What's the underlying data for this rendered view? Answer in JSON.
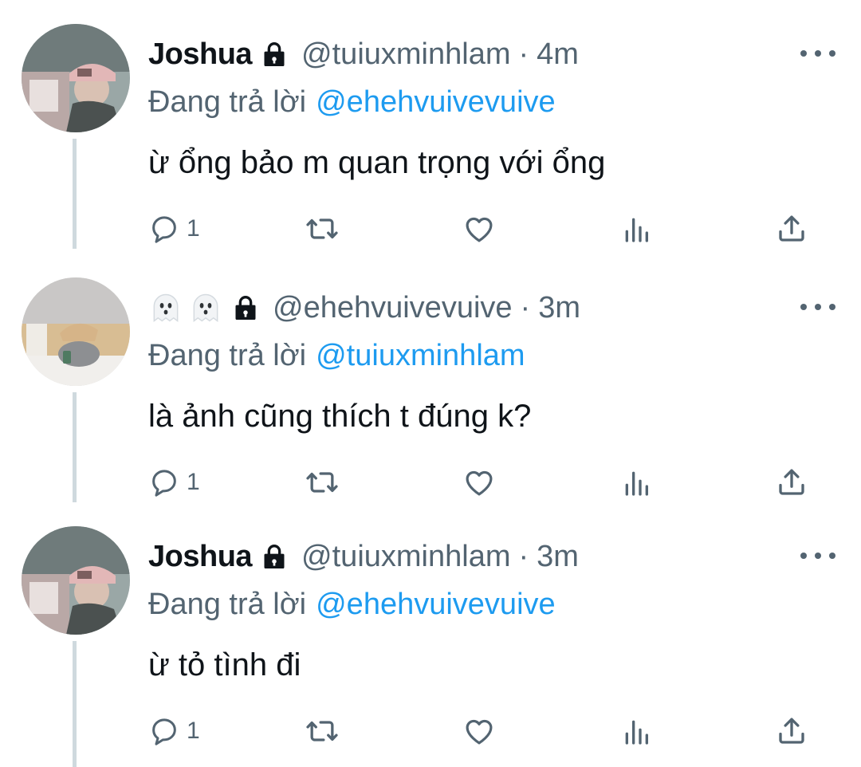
{
  "colors": {
    "text_primary": "#0f1419",
    "text_secondary": "#536471",
    "link": "#1d9bf0",
    "thread_line": "#cfd9de"
  },
  "tweets": [
    {
      "display_name": "Joshua",
      "display_name_type": "text",
      "protected_icon": "lock-icon",
      "handle": "@tuiuxminhlam",
      "separator": "·",
      "time": "4m",
      "replying_label": "Đang trả lời",
      "replying_to": "@ehehvuivevuive",
      "text": "ừ ổng bảo m quan trọng với ổng",
      "reply_count": "1",
      "avatar": "person-with-pink-cap-photo"
    },
    {
      "display_name": "👻👻",
      "display_name_type": "emoji",
      "display_name_icons": [
        "ghost-emoji-icon",
        "ghost-emoji-icon"
      ],
      "protected_icon": "lock-icon",
      "handle": "@ehehvuivevuive",
      "separator": "·",
      "time": "3m",
      "replying_label": "Đang trả lời",
      "replying_to": "@tuiuxminhlam",
      "text": "là ảnh cũng thích t đúng k?",
      "reply_count": "1",
      "avatar": "room-with-hat-photo"
    },
    {
      "display_name": "Joshua",
      "display_name_type": "text",
      "protected_icon": "lock-icon",
      "handle": "@tuiuxminhlam",
      "separator": "·",
      "time": "3m",
      "replying_label": "Đang trả lời",
      "replying_to": "@ehehvuivevuive",
      "text": "ừ tỏ tình đi",
      "reply_count": "1",
      "avatar": "person-with-pink-cap-photo"
    }
  ],
  "action_icons": [
    "reply-icon",
    "retweet-icon",
    "like-icon",
    "views-icon",
    "share-icon"
  ]
}
